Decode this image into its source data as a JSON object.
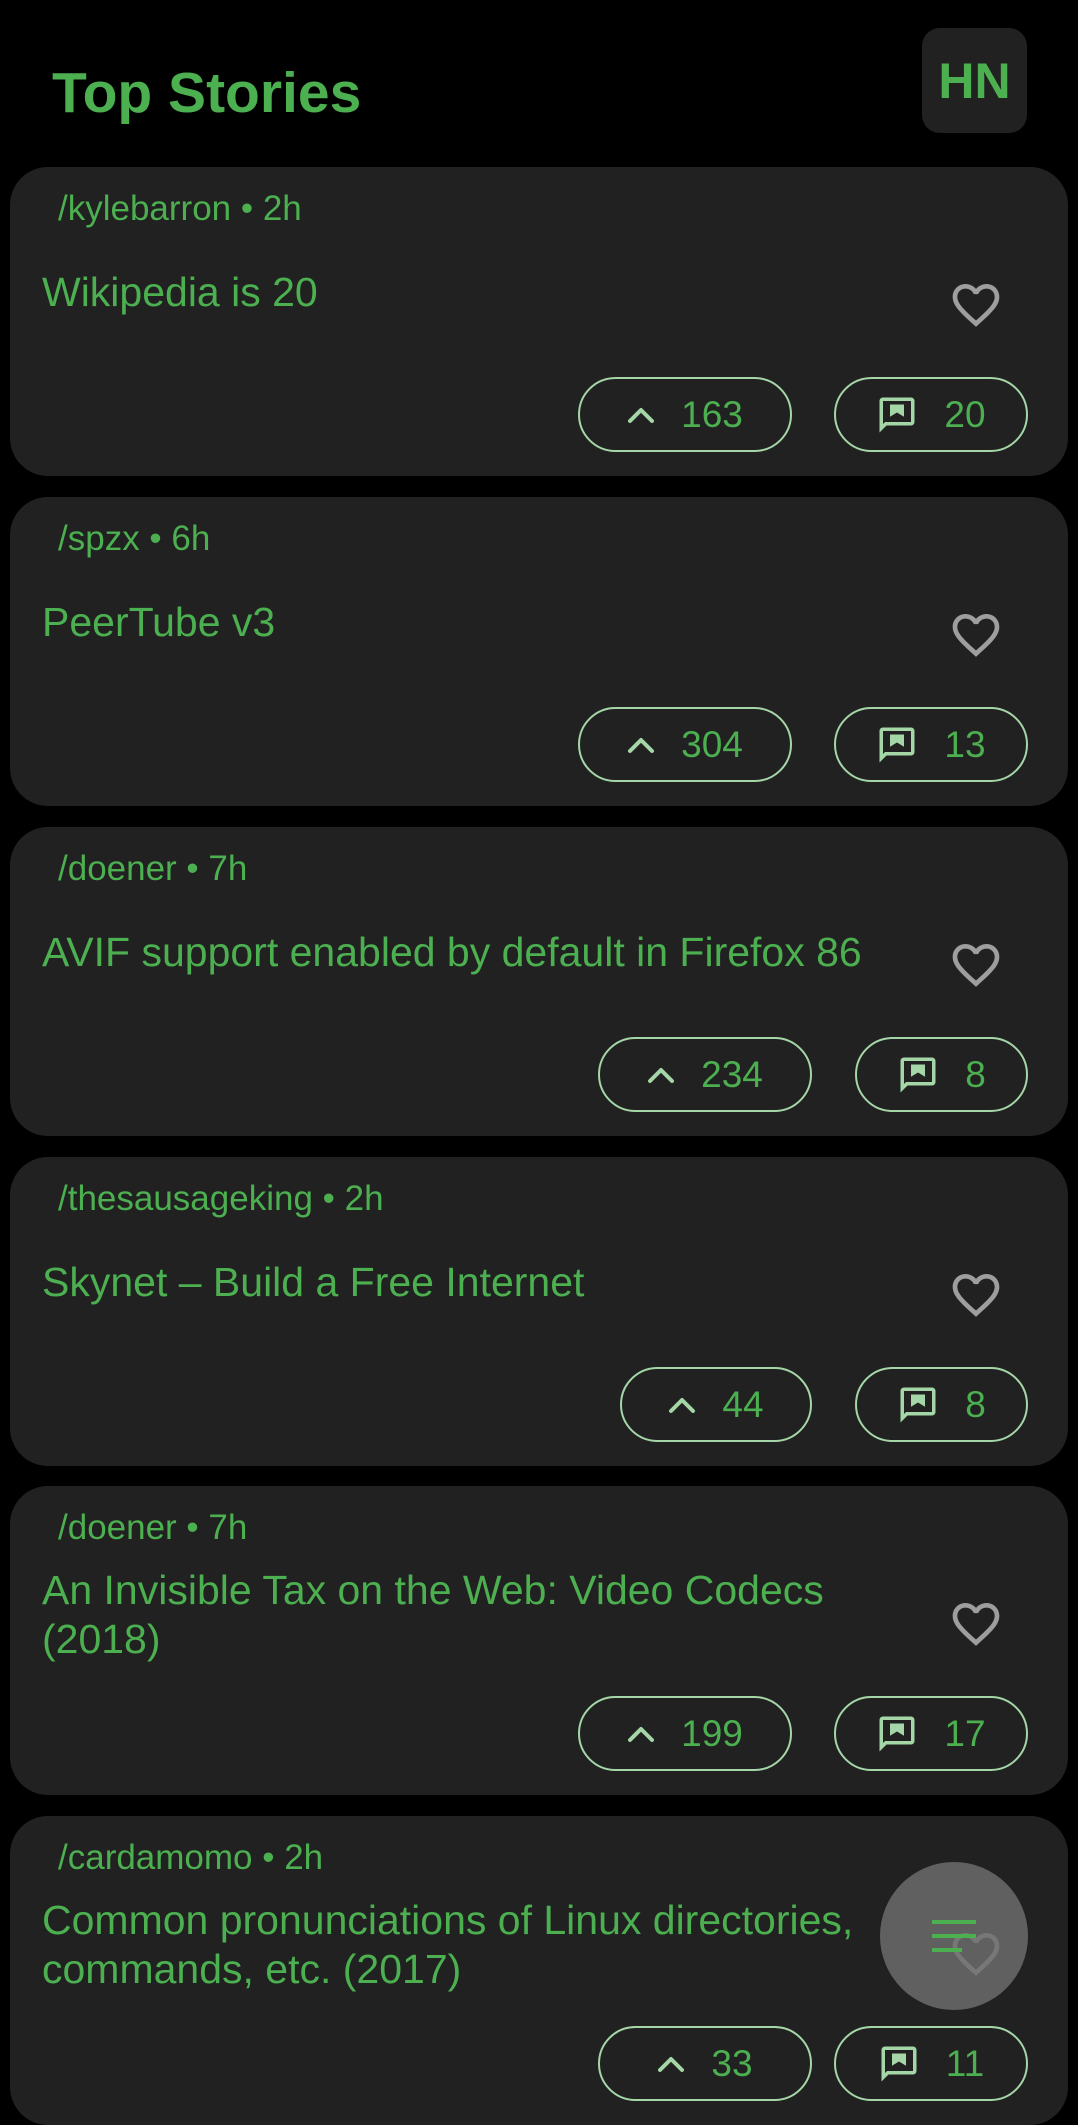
{
  "header": {
    "title": "Top Stories",
    "badge": "HN"
  },
  "stories": [
    {
      "author": "/kylebarron",
      "age": "2h",
      "meta": "/kylebarron • 2h",
      "title": "Wikipedia is 20",
      "points": "163",
      "comments": "20"
    },
    {
      "author": "/spzx",
      "age": "6h",
      "meta": "/spzx • 6h",
      "title": "PeerTube v3",
      "points": "304",
      "comments": "13"
    },
    {
      "author": "/doener",
      "age": "7h",
      "meta": "/doener • 7h",
      "title": "AVIF support enabled by default in Firefox 86",
      "points": "234",
      "comments": "8"
    },
    {
      "author": "/thesausageking",
      "age": "2h",
      "meta": "/thesausageking • 2h",
      "title": "Skynet – Build a Free Internet",
      "points": "44",
      "comments": "8"
    },
    {
      "author": "/doener",
      "age": "7h",
      "meta": "/doener • 7h",
      "title": "An Invisible Tax on the Web: Video Codecs (2018)",
      "points": "199",
      "comments": "17"
    },
    {
      "author": "/cardamomo",
      "age": "2h",
      "meta": "/cardamomo • 2h",
      "title": "Common pronunciations of Linux directories, commands, etc. (2017)",
      "points": "33",
      "comments": "11"
    }
  ],
  "icons": {
    "heart": "heart-outline-icon",
    "upvote": "chevron-up-icon",
    "comments": "comment-icon",
    "menu": "menu-icon"
  },
  "colors": {
    "background": "#000000",
    "card": "#212121",
    "accent": "#4CAF50",
    "outline": "#A5D6A7",
    "heart": "#9E9E9E"
  }
}
